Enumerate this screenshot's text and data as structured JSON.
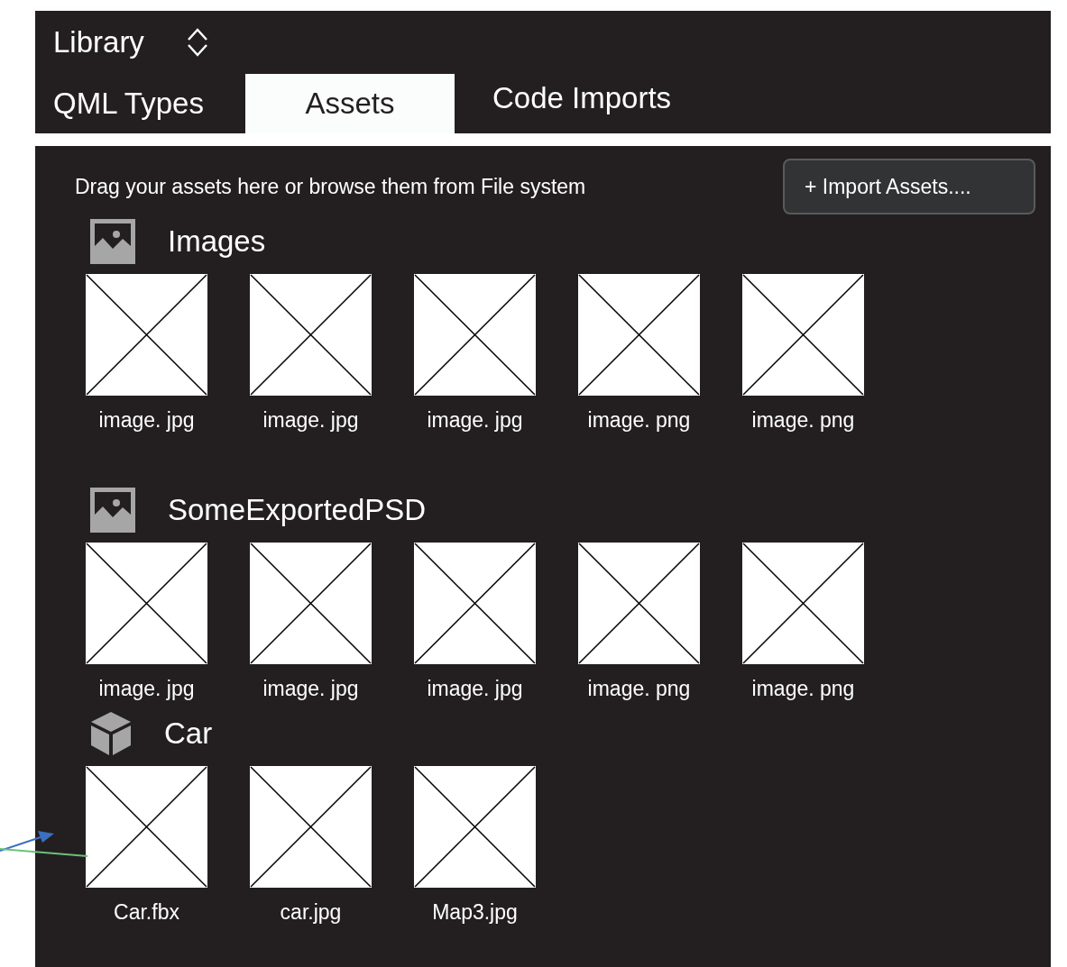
{
  "header": {
    "title": "Library",
    "tabs": [
      {
        "label": "QML Types",
        "selected": false
      },
      {
        "label": "Assets",
        "selected": true
      },
      {
        "label": "Code Imports",
        "selected": false
      }
    ]
  },
  "panel": {
    "hint": "Drag your assets here or browse them from File system",
    "import_button": "+ Import Assets....",
    "sections": [
      {
        "kind": "images",
        "title": "Images",
        "items": [
          "image. jpg",
          "image. jpg",
          "image. jpg",
          "image. png",
          "image. png"
        ]
      },
      {
        "kind": "images",
        "title": "SomeExportedPSD",
        "items": [
          "image. jpg",
          "image. jpg",
          "image. jpg",
          "image. png",
          "image. png"
        ]
      },
      {
        "kind": "model",
        "title": "Car",
        "items": [
          "Car.fbx",
          "car.jpg",
          "Map3.jpg"
        ]
      }
    ]
  }
}
